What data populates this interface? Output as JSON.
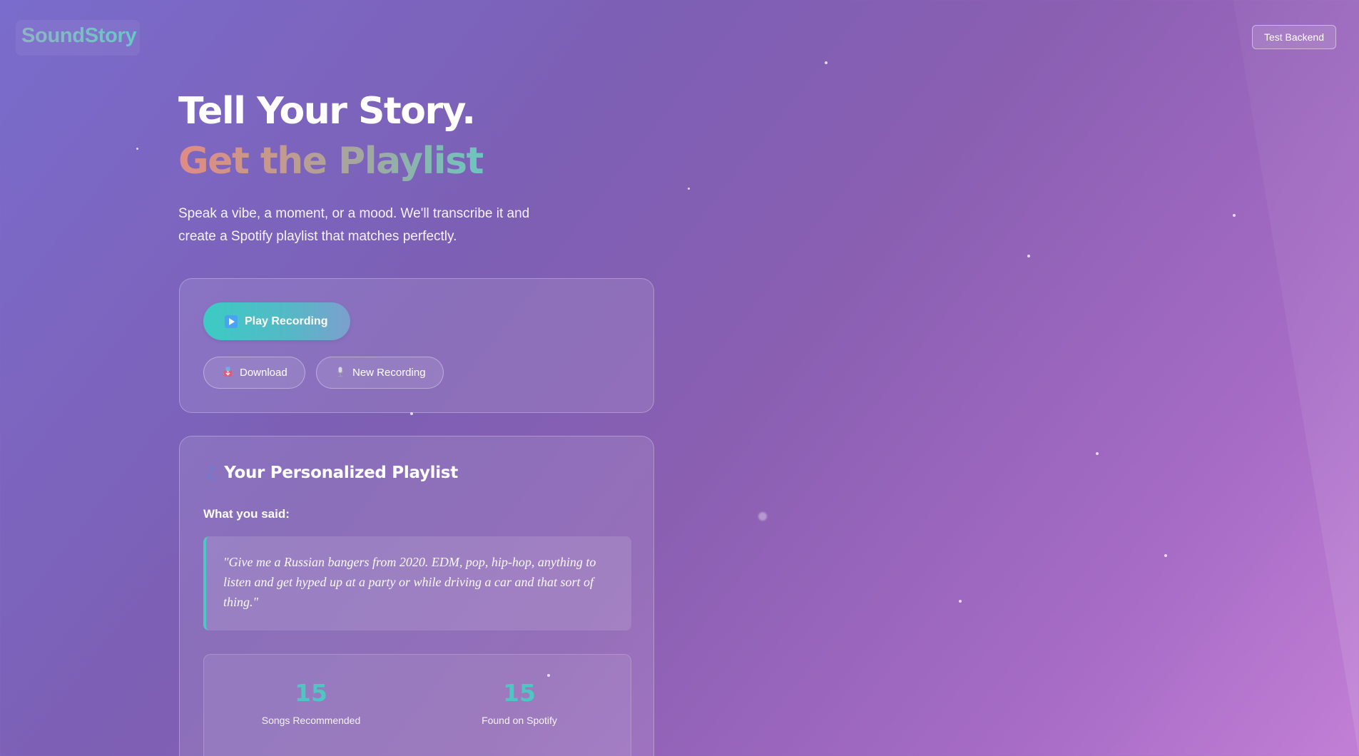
{
  "app": {
    "logo": "SoundStory"
  },
  "header": {
    "test_backend_label": "Test Backend"
  },
  "hero": {
    "title_line1": "Tell Your Story.",
    "title_line2": "Get the Playlist",
    "subtitle": "Speak a vibe, a moment, or a mood. We'll transcribe it and create a Spotify playlist that matches perfectly."
  },
  "recording": {
    "play_label": "Play Recording",
    "download_label": "Download",
    "new_recording_label": "New Recording",
    "icons": {
      "play": "play-icon",
      "download": "download-icon",
      "new_recording": "microphone-icon"
    }
  },
  "playlist": {
    "title": "Your Personalized Playlist",
    "title_icon": "music-note-icon",
    "said_label": "What you said:",
    "transcript": "\"Give me a Russian bangers from 2020. EDM, pop, hip-hop, anything to listen and get hyped up at a party or while driving a car and that sort of thing.\"",
    "stats": [
      {
        "value": "15",
        "label": "Songs Recommended"
      },
      {
        "value": "15",
        "label": "Found on Spotify"
      }
    ]
  },
  "colors": {
    "accent_teal": "#4cc7c1",
    "background_start": "#7a6ccc",
    "background_end": "#c27fd6"
  }
}
